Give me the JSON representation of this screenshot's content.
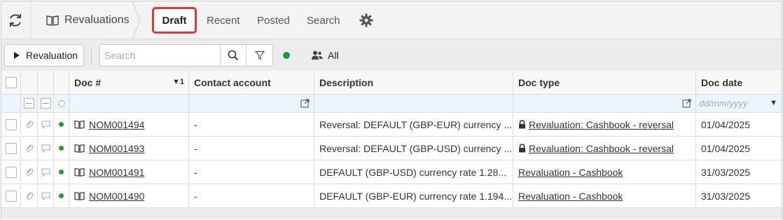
{
  "nav": {
    "app_name": "Revaluations",
    "tabs": [
      {
        "label": "Draft",
        "active": true
      },
      {
        "label": "Recent"
      },
      {
        "label": "Posted"
      },
      {
        "label": "Search"
      }
    ]
  },
  "toolbar": {
    "revaluation_label": "Revaluation",
    "search_placeholder": "Search",
    "all_label": "All"
  },
  "table": {
    "columns": [
      "Doc #",
      "Contact account",
      "Description",
      "Doc type",
      "Doc date"
    ],
    "sort_indicator": "1",
    "filter_date_placeholder": "dd/mm/yyyy",
    "rows": [
      {
        "doc": "NOM001494",
        "contact": "-",
        "description": "Reversal: DEFAULT (GBP-EUR) currency ...",
        "doc_type": "Revaluation: Cashbook - reversal",
        "locked": true,
        "date": "01/04/2025"
      },
      {
        "doc": "NOM001493",
        "contact": "-",
        "description": "Reversal: DEFAULT (GBP-USD) currency ...",
        "doc_type": "Revaluation: Cashbook - reversal",
        "locked": true,
        "date": "01/04/2025"
      },
      {
        "doc": "NOM001491",
        "contact": "-",
        "description": "DEFAULT (GBP-USD) currency rate 1.28...",
        "doc_type": "Revaluation - Cashbook",
        "locked": false,
        "date": "31/03/2025"
      },
      {
        "doc": "NOM001490",
        "contact": "-",
        "description": "DEFAULT (GBP-EUR) currency rate 1.194...",
        "doc_type": "Revaluation - Cashbook",
        "locked": false,
        "date": "31/03/2025"
      }
    ]
  },
  "colors": {
    "status_green": "#1e9a3c",
    "highlight_red": "#d93a3a",
    "filter_row_bg": "#eaf6fb"
  }
}
